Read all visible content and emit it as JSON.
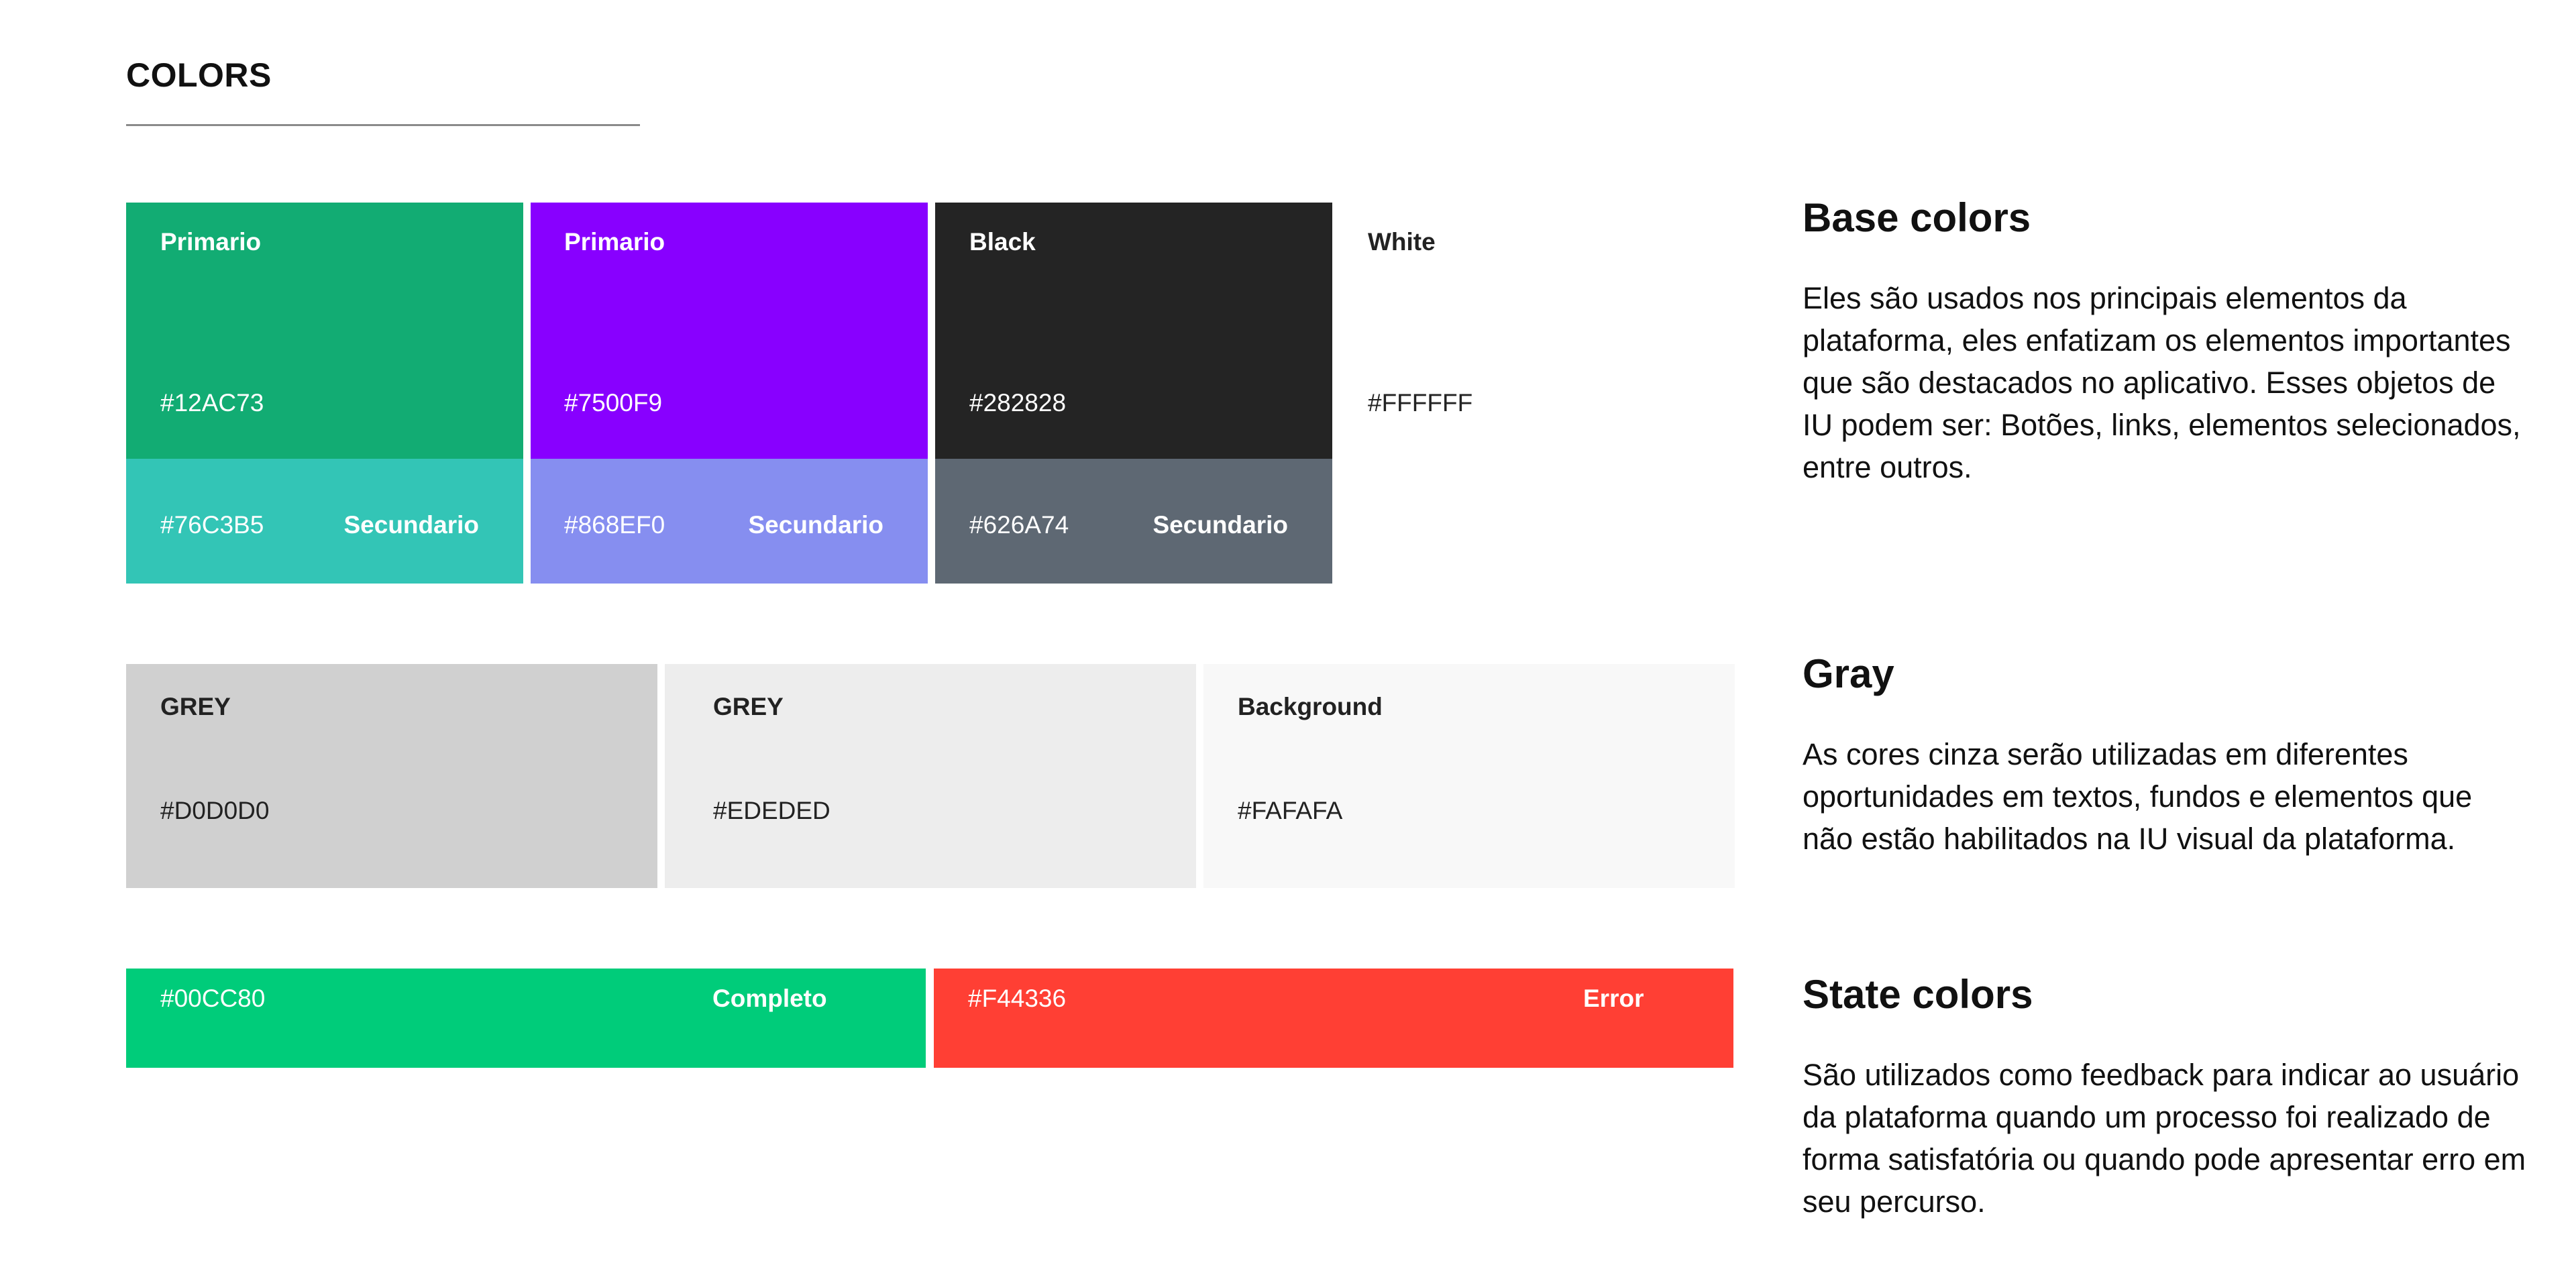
{
  "header": {
    "title": "COLORS"
  },
  "base": {
    "primary_green": {
      "name": "Primario",
      "hex": "#12AC73",
      "color": "#12AC73"
    },
    "primary_purple": {
      "name": "Primario",
      "hex": "#7500F9",
      "color": "#8800FF"
    },
    "black": {
      "name": "Black",
      "hex": "#282828",
      "color": "#242424"
    },
    "white": {
      "name": "White",
      "hex": "#FFFFFF",
      "color": "#FFFFFF"
    },
    "secondary_green": {
      "hex": "#76C3B5",
      "label": "Secundario",
      "color": "#33C5B6"
    },
    "secondary_purple": {
      "hex": "#868EF0",
      "label": "Secundario",
      "color": "#868EF0"
    },
    "secondary_gray": {
      "hex": "#626A74",
      "label": "Secundario",
      "color": "#5E6873"
    }
  },
  "grays": {
    "grey1": {
      "name": "GREY",
      "hex": "#D0D0D0",
      "color": "#D0D0D0"
    },
    "grey2": {
      "name": "GREY",
      "hex": "#EDEDED",
      "color": "#EDEDED"
    },
    "background": {
      "name": "Background",
      "hex": "#FAFAFA",
      "color": "#F8F8F8"
    }
  },
  "states": {
    "complete": {
      "hex": "#00CC80",
      "label": "Completo",
      "color": "#00CC7A"
    },
    "error": {
      "hex": "#F44336",
      "label": "Error",
      "color": "#FF3F34"
    }
  },
  "sections": {
    "base": {
      "heading": "Base colors",
      "description": "Eles são usados nos principais elementos da plataforma, eles enfatizam os elementos importantes que são destacados no aplicativo. Esses objetos de IU podem ser: Botões, links, elementos selecionados, entre outros."
    },
    "gray": {
      "heading": "Gray",
      "description": "As cores cinza serão utilizadas em diferentes oportunidades em textos, fundos e elementos que não estão habilitados na IU visual da plataforma."
    },
    "state": {
      "heading": "State colors",
      "description": "São utilizados como feedback para indicar ao usuário da plataforma quando um processo foi realizado de forma satisfatória ou quando pode apresentar erro em seu percurso."
    }
  }
}
